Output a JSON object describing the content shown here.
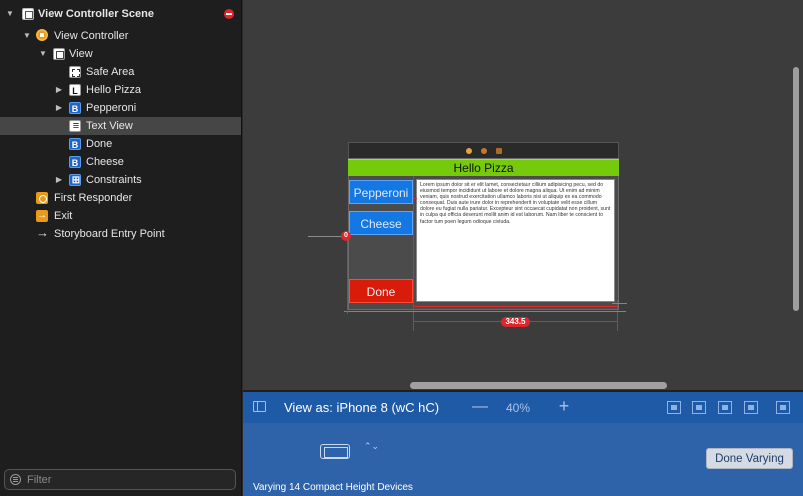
{
  "outline": {
    "items": [
      {
        "label": "View Controller Scene",
        "icon": "scene-icon",
        "disclosure": "expanded",
        "bold": true
      },
      {
        "label": "View Controller",
        "icon": "view-controller-icon",
        "disclosure": "expanded"
      },
      {
        "label": "View",
        "icon": "view-icon",
        "disclosure": "expanded"
      },
      {
        "label": "Safe Area",
        "icon": "safe-area-icon",
        "disclosure": "none"
      },
      {
        "label": "Hello Pizza",
        "icon": "label-icon",
        "icon_glyph": "L",
        "disclosure": "collapsed"
      },
      {
        "label": "Pepperoni",
        "icon": "button-icon",
        "icon_glyph": "B",
        "disclosure": "collapsed"
      },
      {
        "label": "Text View",
        "icon": "text-view-icon",
        "disclosure": "none",
        "selected": true
      },
      {
        "label": "Done",
        "icon": "button-icon",
        "icon_glyph": "B",
        "disclosure": "none"
      },
      {
        "label": "Cheese",
        "icon": "button-icon",
        "icon_glyph": "B",
        "disclosure": "none"
      },
      {
        "label": "Constraints",
        "icon": "constraints-icon",
        "disclosure": "collapsed"
      },
      {
        "label": "First Responder",
        "icon": "first-responder-icon",
        "disclosure": "none"
      },
      {
        "label": "Exit",
        "icon": "exit-icon",
        "disclosure": "none"
      },
      {
        "label": "Storyboard Entry Point",
        "icon": "entry-arrow-icon",
        "icon_glyph": "→",
        "disclosure": "none"
      }
    ],
    "error_badge": "error-icon",
    "filter": {
      "placeholder": "Filter",
      "value": ""
    }
  },
  "scene": {
    "title_label": "Hello Pizza",
    "buttons": {
      "pepperoni": "Pepperoni",
      "cheese": "Cheese",
      "done": "Done"
    },
    "text_view": "Lorem ipsum dolor sit er elit lamet, consectetaur cillium adipisicing pecu, sed do eiusmod tempor incididunt ut labore et dolore magna aliqua. Ut enim ad minim veniam, quis nostrud exercitation ullamco laboris nisi ut aliquip ex ea commodo consequat. Duis aute irure dolor in reprehenderit in voluptate velit esse cillum dolore eu fugiat nulla pariatur. Excepteur sint occaecat cupidatat non proident, sunt in culpa qui officia deserunt mollit anim id est laborum. Nam liber te conscient to factor tum poen legum odioque civiuda.",
    "constraint_width": "343.5",
    "constraint_zero": "0",
    "colors": {
      "label_bg": "#74ca0b",
      "button_blue": "#1478e4",
      "button_red": "#d91c0a",
      "constraint_red": "#e0262b"
    }
  },
  "device_bar": {
    "view_as": "View as: iPhone 8 (wC hC)",
    "zoom_out": "—",
    "zoom_level": "40%",
    "zoom_in": "+",
    "icons": [
      "embed-in-icon",
      "align-icon",
      "pin-icon",
      "resolve-issues-icon",
      "update-frames-icon"
    ]
  },
  "varying": {
    "done_button": "Done Varying",
    "status": "Varying 14 Compact Height Devices",
    "stepper": "⌃⌄"
  }
}
